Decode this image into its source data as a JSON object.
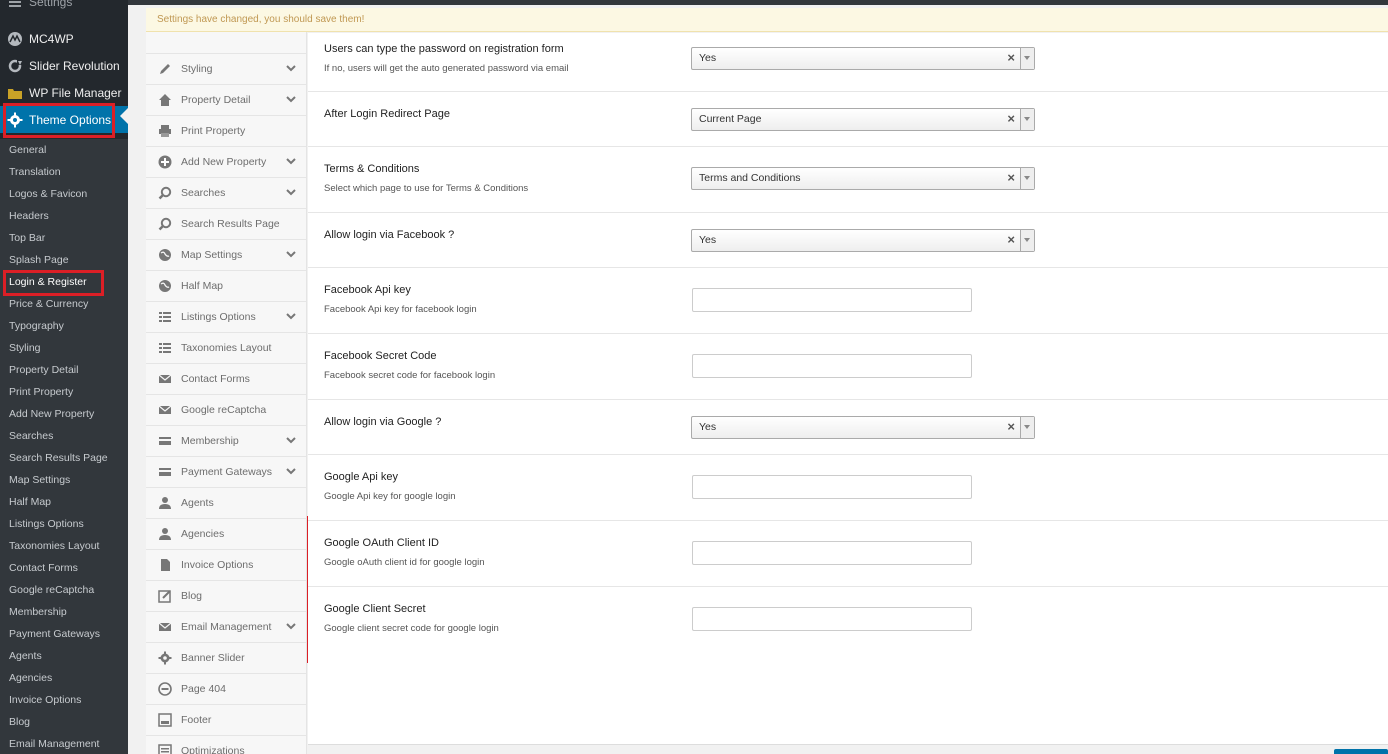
{
  "wp_menu": {
    "cut_item": "Settings",
    "top_items": [
      {
        "label": "MC4WP",
        "icon": "mc4wp-icon"
      },
      {
        "label": "Slider Revolution",
        "icon": "refresh-icon"
      },
      {
        "label": "WP File Manager",
        "icon": "folder-icon"
      },
      {
        "label": "Theme Options",
        "icon": "gear-icon",
        "active": true
      }
    ],
    "submenu": [
      "General",
      "Translation",
      "Logos & Favicon",
      "Headers",
      "Top Bar",
      "Splash Page",
      "Login & Register",
      "Price & Currency",
      "Typography",
      "Styling",
      "Property Detail",
      "Print Property",
      "Add New Property",
      "Searches",
      "Search Results Page",
      "Map Settings",
      "Half Map",
      "Listings Options",
      "Taxonomies Layout",
      "Contact Forms",
      "Google reCaptcha",
      "Membership",
      "Payment Gateways",
      "Agents",
      "Agencies",
      "Invoice Options",
      "Blog",
      "Email Management"
    ],
    "current_submenu": "Login & Register"
  },
  "notice": "Settings have changed, you should save them!",
  "redux_menu": [
    {
      "label": "Styling",
      "icon": "pencil-icon",
      "expandable": true
    },
    {
      "label": "Property Detail",
      "icon": "home-icon",
      "expandable": true
    },
    {
      "label": "Print Property",
      "icon": "print-icon",
      "expandable": false
    },
    {
      "label": "Add New Property",
      "icon": "plus-circle-icon",
      "expandable": true
    },
    {
      "label": "Searches",
      "icon": "search-icon",
      "expandable": true
    },
    {
      "label": "Search Results Page",
      "icon": "search-icon",
      "expandable": false
    },
    {
      "label": "Map Settings",
      "icon": "globe-icon",
      "expandable": true
    },
    {
      "label": "Half Map",
      "icon": "globe-icon",
      "expandable": false
    },
    {
      "label": "Listings Options",
      "icon": "list-icon",
      "expandable": true
    },
    {
      "label": "Taxonomies Layout",
      "icon": "list-icon",
      "expandable": false
    },
    {
      "label": "Contact Forms",
      "icon": "envelope-icon",
      "expandable": false
    },
    {
      "label": "Google reCaptcha",
      "icon": "envelope-icon",
      "expandable": false
    },
    {
      "label": "Membership",
      "icon": "card-icon",
      "expandable": true
    },
    {
      "label": "Payment Gateways",
      "icon": "card-icon",
      "expandable": true
    },
    {
      "label": "Agents",
      "icon": "user-icon",
      "expandable": false
    },
    {
      "label": "Agencies",
      "icon": "user-icon",
      "expandable": false
    },
    {
      "label": "Invoice Options",
      "icon": "file-icon",
      "expandable": false
    },
    {
      "label": "Blog",
      "icon": "edit-icon",
      "expandable": false
    },
    {
      "label": "Email Management",
      "icon": "envelope-icon",
      "expandable": true
    },
    {
      "label": "Banner Slider",
      "icon": "gear-icon",
      "expandable": false
    },
    {
      "label": "Page 404",
      "icon": "minus-circle-icon",
      "expandable": false
    },
    {
      "label": "Footer",
      "icon": "footer-icon",
      "expandable": false
    },
    {
      "label": "Optimizations",
      "icon": "optimize-icon",
      "expandable": false
    }
  ],
  "fields": [
    {
      "title": "Users can type the password on registration form",
      "subtitle": "If no, users will get the auto generated password via email",
      "type": "select",
      "value": "Yes"
    },
    {
      "title": "After Login Redirect Page",
      "subtitle": "",
      "type": "select",
      "value": "Current Page"
    },
    {
      "title": "Terms & Conditions",
      "subtitle": "Select which page to use for Terms & Conditions",
      "type": "select",
      "value": "Terms and Conditions"
    },
    {
      "title": "Allow login via Facebook ?",
      "subtitle": "",
      "type": "select",
      "value": "Yes"
    },
    {
      "title": "Facebook Api key",
      "subtitle": "Facebook Api key for facebook login",
      "type": "text",
      "value": ""
    },
    {
      "title": "Facebook Secret Code",
      "subtitle": "Facebook secret code for facebook login",
      "type": "text",
      "value": ""
    },
    {
      "title": "Allow login via Google ?",
      "subtitle": "",
      "type": "select",
      "value": "Yes"
    },
    {
      "title": "Google Api key",
      "subtitle": "Google Api key for google login",
      "type": "text",
      "value": ""
    },
    {
      "title": "Google OAuth Client ID",
      "subtitle": "Google oAuth client id for google login",
      "type": "text",
      "value": ""
    },
    {
      "title": "Google Client Secret",
      "subtitle": "Google client secret code for google login",
      "type": "text",
      "value": ""
    }
  ],
  "colors": {
    "highlight": "#dc1f26",
    "wp_active": "#0073aa",
    "sidebar": "#23282d"
  }
}
